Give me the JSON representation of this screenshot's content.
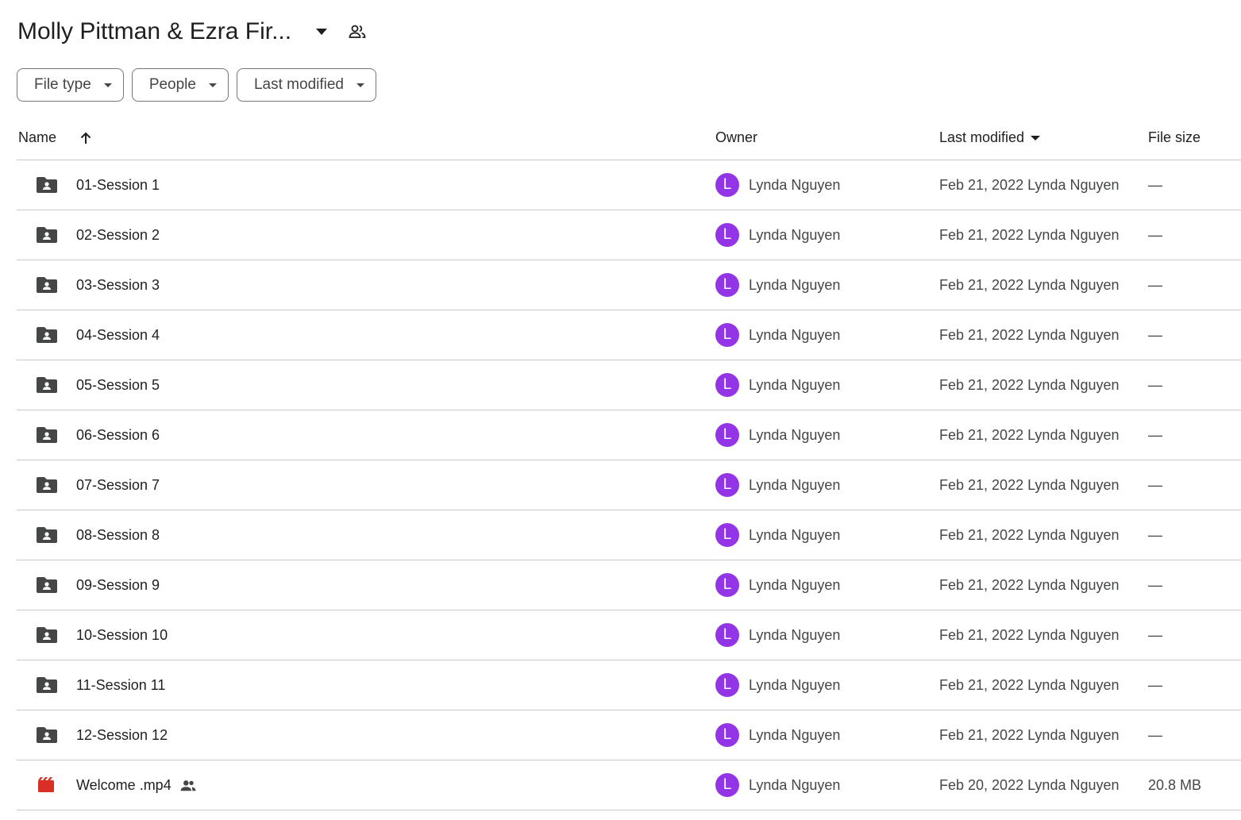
{
  "header": {
    "title": "Molly Pittman & Ezra Fir..."
  },
  "filters": [
    {
      "label": "File type"
    },
    {
      "label": "People"
    },
    {
      "label": "Last modified"
    }
  ],
  "columns": {
    "name": "Name",
    "owner": "Owner",
    "last_modified": "Last modified",
    "file_size": "File size"
  },
  "colors": {
    "avatar": "#9334e6",
    "folder_icon": "#444746",
    "video_icon": "#d93025"
  },
  "rows": [
    {
      "name": "01-Session 1",
      "type": "shared-folder-icon",
      "owner_initial": "L",
      "owner": "Lynda Nguyen",
      "modified": "Feb 21, 2022 Lynda Nguyen",
      "size": "—"
    },
    {
      "name": "02-Session 2",
      "type": "shared-folder-icon",
      "owner_initial": "L",
      "owner": "Lynda Nguyen",
      "modified": "Feb 21, 2022 Lynda Nguyen",
      "size": "—"
    },
    {
      "name": "03-Session 3",
      "type": "shared-folder-icon",
      "owner_initial": "L",
      "owner": "Lynda Nguyen",
      "modified": "Feb 21, 2022 Lynda Nguyen",
      "size": "—"
    },
    {
      "name": "04-Session 4",
      "type": "shared-folder-icon",
      "owner_initial": "L",
      "owner": "Lynda Nguyen",
      "modified": "Feb 21, 2022 Lynda Nguyen",
      "size": "—"
    },
    {
      "name": "05-Session 5",
      "type": "shared-folder-icon",
      "owner_initial": "L",
      "owner": "Lynda Nguyen",
      "modified": "Feb 21, 2022 Lynda Nguyen",
      "size": "—"
    },
    {
      "name": "06-Session 6",
      "type": "shared-folder-icon",
      "owner_initial": "L",
      "owner": "Lynda Nguyen",
      "modified": "Feb 21, 2022 Lynda Nguyen",
      "size": "—"
    },
    {
      "name": "07-Session 7",
      "type": "shared-folder-icon",
      "owner_initial": "L",
      "owner": "Lynda Nguyen",
      "modified": "Feb 21, 2022 Lynda Nguyen",
      "size": "—"
    },
    {
      "name": "08-Session 8",
      "type": "shared-folder-icon",
      "owner_initial": "L",
      "owner": "Lynda Nguyen",
      "modified": "Feb 21, 2022 Lynda Nguyen",
      "size": "—"
    },
    {
      "name": "09-Session 9",
      "type": "shared-folder-icon",
      "owner_initial": "L",
      "owner": "Lynda Nguyen",
      "modified": "Feb 21, 2022 Lynda Nguyen",
      "size": "—"
    },
    {
      "name": "10-Session 10",
      "type": "shared-folder-icon",
      "owner_initial": "L",
      "owner": "Lynda Nguyen",
      "modified": "Feb 21, 2022 Lynda Nguyen",
      "size": "—"
    },
    {
      "name": "11-Session 11",
      "type": "shared-folder-icon",
      "owner_initial": "L",
      "owner": "Lynda Nguyen",
      "modified": "Feb 21, 2022 Lynda Nguyen",
      "size": "—"
    },
    {
      "name": "12-Session 12",
      "type": "shared-folder-icon",
      "owner_initial": "L",
      "owner": "Lynda Nguyen",
      "modified": "Feb 21, 2022 Lynda Nguyen",
      "size": "—"
    },
    {
      "name": "Welcome .mp4",
      "type": "video-file-icon",
      "shared": true,
      "owner_initial": "L",
      "owner": "Lynda Nguyen",
      "modified": "Feb 20, 2022 Lynda Nguyen",
      "size": "20.8 MB"
    }
  ]
}
